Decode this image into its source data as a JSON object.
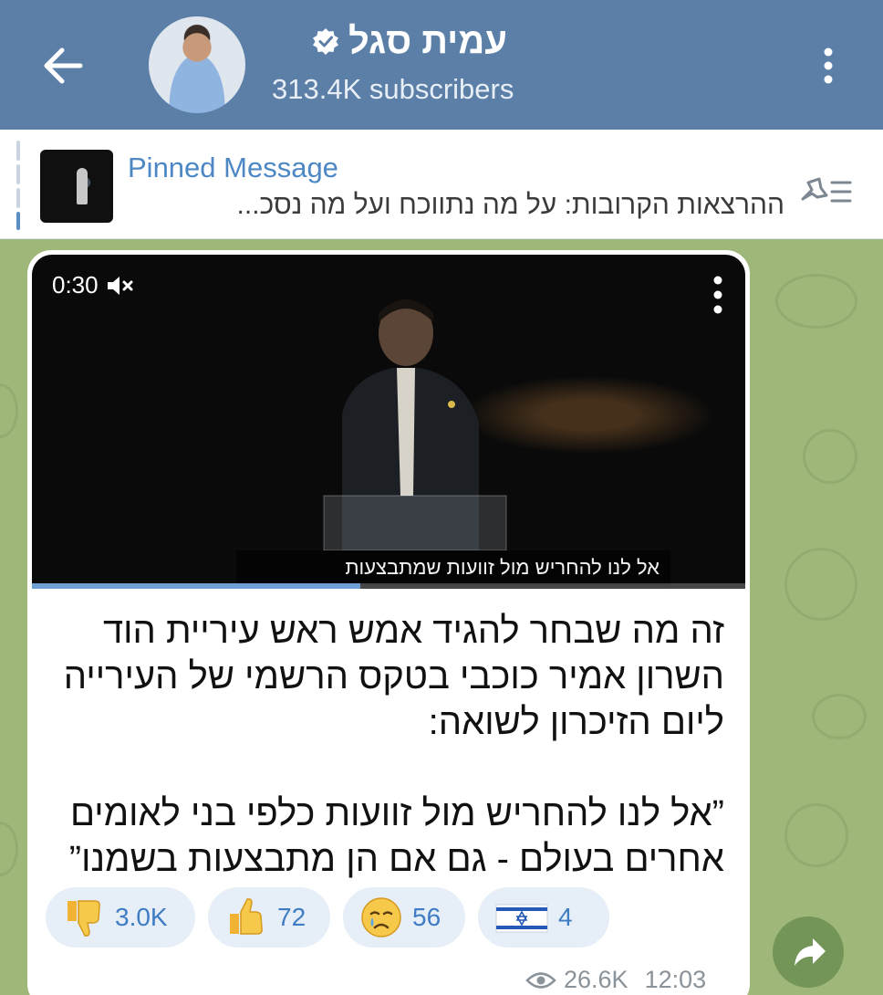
{
  "header": {
    "channel_name": "עמית סגל",
    "subscribers": "313.4K subscribers",
    "colors": {
      "bar": "#5b7fa6",
      "verified": "#ffffff"
    },
    "icons": {
      "back": "arrow-left-icon",
      "verified": "verified-badge-icon",
      "menu": "more-vertical-icon"
    }
  },
  "pinned": {
    "title": "Pinned Message",
    "preview_text": "ההרצאות הקרובות:  על מה נתווכח ועל מה נסכ...",
    "icons": {
      "unpin": "unpin-list-icon"
    },
    "accent": "#4d88c4"
  },
  "message": {
    "video": {
      "duration": "0:30",
      "caption": "אל לנו להחריש מול זוועות שמתבצעות",
      "progress": 0.46,
      "icons": {
        "mute": "speaker-muted-icon",
        "menu": "more-vertical-icon"
      }
    },
    "text_lines": [
      "זה מה שבחר להגיד אמש ראש עיריית הוד",
      "השרון אמיר כוכבי בטקס הרשמי של העירייה",
      "ליום הזיכרון לשואה:",
      "",
      "”אל לנו להחריש מול זוועות כלפי בני לאומים",
      "אחרים בעולם - גם אם הן מתבצעות בשמנו”"
    ],
    "reactions": [
      {
        "emoji": "thumbs-down-icon",
        "count": "3.0K"
      },
      {
        "emoji": "thumbs-up-icon",
        "count": "72"
      },
      {
        "emoji": "crying-face-icon",
        "count": "56"
      },
      {
        "emoji": "israel-flag-icon",
        "count": "4"
      }
    ],
    "views": "26.6K",
    "time": "12:03",
    "icons": {
      "views": "eye-icon",
      "share": "share-arrow-icon"
    }
  }
}
